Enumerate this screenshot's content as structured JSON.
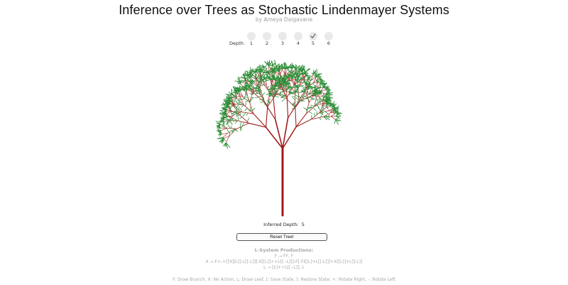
{
  "header": {
    "title": "Inference over Trees as Stochastic Lindenmayer Systems",
    "byline": "by Ameya Daigavane"
  },
  "depth_selector": {
    "label": "Depth:",
    "options": [
      "1",
      "2",
      "3",
      "4",
      "5",
      "6"
    ],
    "selected": "5"
  },
  "tree": {
    "branch_color": "#a31818",
    "leaf_color": "#2f8f3a"
  },
  "inferred": {
    "label": "Inferred Depth:",
    "value": "5"
  },
  "reset_button": {
    "label": "Reset Tree!"
  },
  "productions": {
    "title": "L-System Productions:",
    "rules": [
      "F → FF, F",
      "X → F+-+[[X][L]]-L[[-L]]]-X[[L]]++L[[--L]]]-F[-FI[[L]+L[[-L]]]+X[[L]]+L]]-L]]",
      "L → [L]++L[[--L]], L"
    ]
  },
  "legend": "F: Draw Branch, X: No Action, L: Draw Leaf, [: Save State, ]: Restore State, +: Rotate Right, -: Rotate Left"
}
